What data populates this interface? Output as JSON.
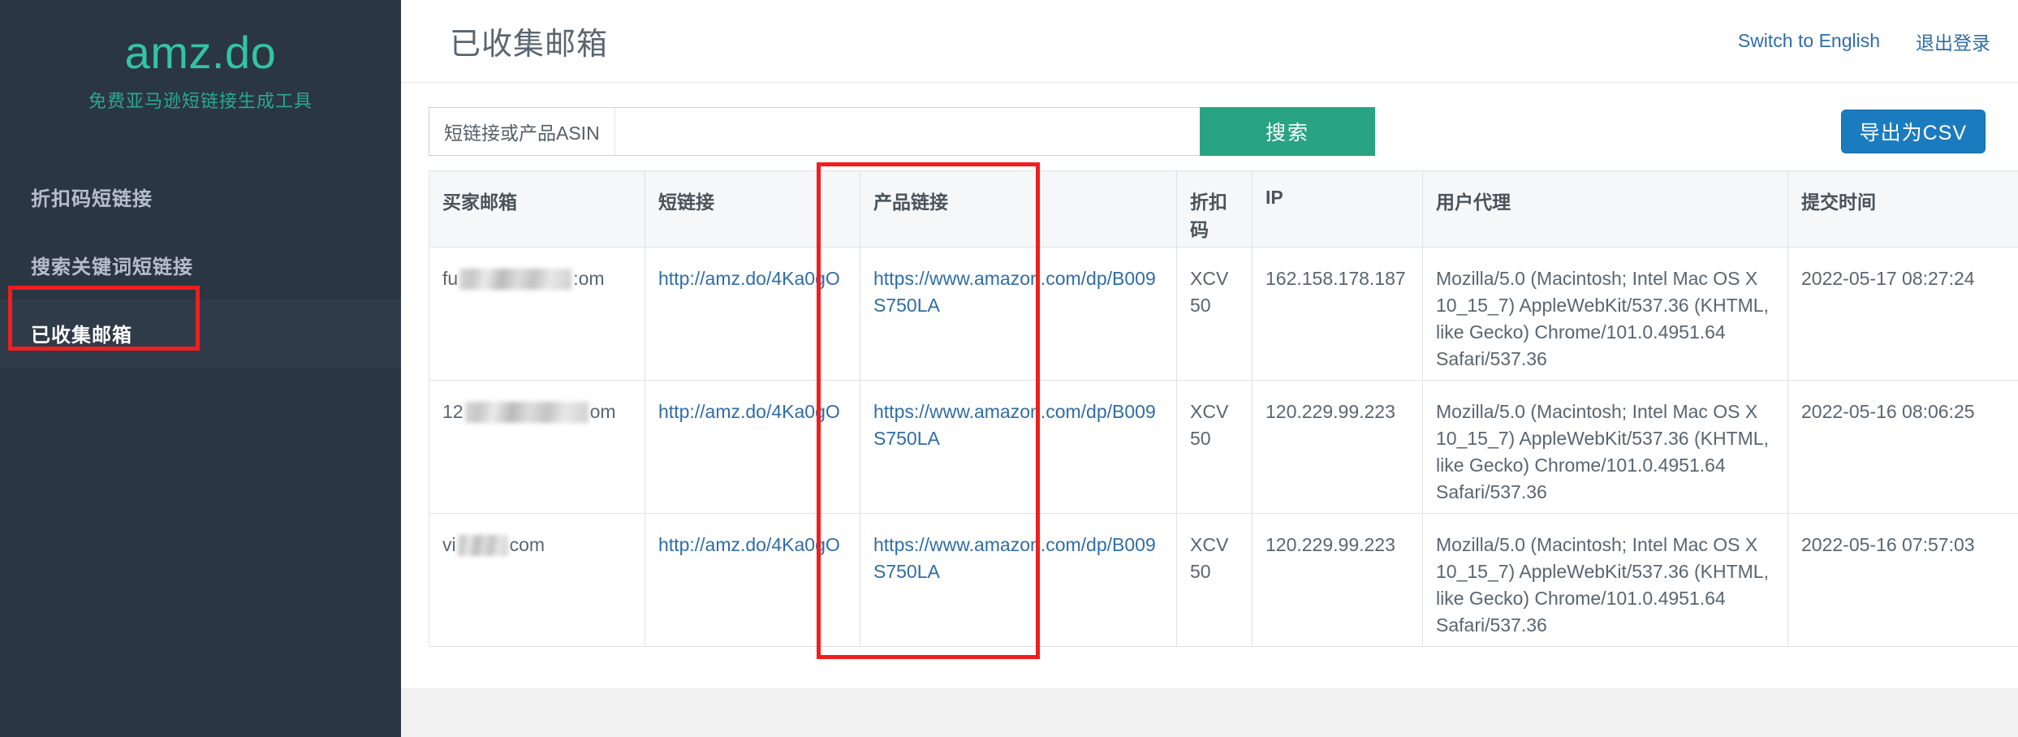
{
  "brand": {
    "name": "amz.do",
    "tagline": "免费亚马逊短链接生成工具",
    "accent_color": "#32c5a0"
  },
  "sidebar": {
    "background_color": "#2b3643",
    "items": [
      {
        "label": "折扣码短链接",
        "active": false
      },
      {
        "label": "搜索关键词短链接",
        "active": false
      },
      {
        "label": "已收集邮箱",
        "active": true
      }
    ]
  },
  "header": {
    "title": "已收集邮箱",
    "links": [
      {
        "label": "Switch to English"
      },
      {
        "label": "退出登录"
      }
    ],
    "link_color": "#2f6da8"
  },
  "toolbar": {
    "search_addon_label": "短链接或产品ASIN",
    "search_input_value": "",
    "search_input_placeholder": "",
    "search_button_label": "搜索",
    "search_button_color": "#28a383",
    "export_button_label": "导出为CSV",
    "export_button_color": "#1b7bbf"
  },
  "annotations": {
    "highlight_color": "#f01e1e",
    "boxes": [
      {
        "target": "sidebar-item-collected-emails"
      },
      {
        "target": "buyer-email-column"
      },
      {
        "target": "export-csv-button"
      }
    ]
  },
  "table": {
    "columns": [
      "买家邮箱",
      "短链接",
      "产品链接",
      "折扣码",
      "IP",
      "用户代理",
      "提交时间"
    ],
    "rows": [
      {
        "email_prefix": "fu",
        "email_suffix": ":om",
        "email_redacted": true,
        "short_link": "http://amz.do/4Ka0gO",
        "product_link": "https://www.amazon.com/dp/B009S750LA",
        "discount_code": "XCV50",
        "ip": "162.158.178.187",
        "user_agent": "Mozilla/5.0 (Macintosh; Intel Mac OS X 10_15_7) AppleWebKit/537.36 (KHTML, like Gecko) Chrome/101.0.4951.64 Safari/537.36",
        "submit_time": "2022-05-17 08:27:24"
      },
      {
        "email_prefix": "12",
        "email_suffix": "om",
        "email_redacted": true,
        "short_link": "http://amz.do/4Ka0gO",
        "product_link": "https://www.amazon.com/dp/B009S750LA",
        "discount_code": "XCV50",
        "ip": "120.229.99.223",
        "user_agent": "Mozilla/5.0 (Macintosh; Intel Mac OS X 10_15_7) AppleWebKit/537.36 (KHTML, like Gecko) Chrome/101.0.4951.64 Safari/537.36",
        "submit_time": "2022-05-16 08:06:25"
      },
      {
        "email_prefix": "vi",
        "email_suffix": "com",
        "email_redacted": true,
        "short_link": "http://amz.do/4Ka0gO",
        "product_link": "https://www.amazon.com/dp/B009S750LA",
        "discount_code": "XCV50",
        "ip": "120.229.99.223",
        "user_agent": "Mozilla/5.0 (Macintosh; Intel Mac OS X 10_15_7) AppleWebKit/537.36 (KHTML, like Gecko) Chrome/101.0.4951.64 Safari/537.36",
        "submit_time": "2022-05-16 07:57:03"
      }
    ]
  }
}
